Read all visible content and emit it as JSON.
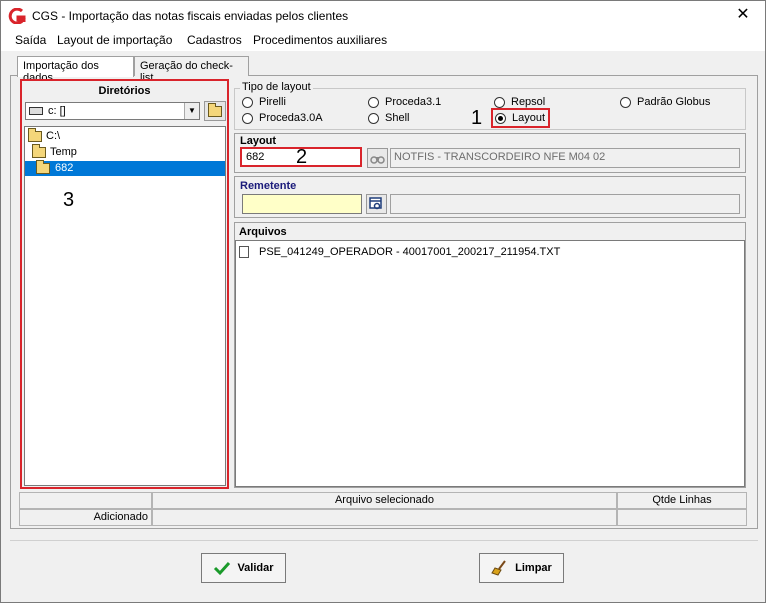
{
  "window": {
    "title": "CGS - Importação das notas fiscais enviadas pelos clientes",
    "close_glyph": "✕"
  },
  "menu": {
    "items": [
      "Saída",
      "Layout de importação",
      "Cadastros",
      "Procedimentos auxiliares"
    ]
  },
  "tabs": [
    {
      "label": "Importação dos dados",
      "active": true
    },
    {
      "label": "Geração do check-list",
      "active": false
    }
  ],
  "directories": {
    "title": "Diretórios",
    "drive": "c: []",
    "tree": [
      {
        "label": "C:\\",
        "level": 0,
        "selected": false
      },
      {
        "label": "Temp",
        "level": 1,
        "selected": false
      },
      {
        "label": "682",
        "level": 2,
        "selected": true
      }
    ]
  },
  "layout_type": {
    "legend": "Tipo de layout",
    "options": [
      {
        "label": "Pirelli",
        "checked": false
      },
      {
        "label": "Proceda3.1",
        "checked": false
      },
      {
        "label": "Repsol",
        "checked": false
      },
      {
        "label": "Padrão Globus",
        "checked": false
      },
      {
        "label": "Proceda3.0A",
        "checked": false
      },
      {
        "label": "Shell",
        "checked": false
      },
      {
        "label": "Layout",
        "checked": true
      }
    ]
  },
  "layout": {
    "label": "Layout",
    "code": "682",
    "description": "NOTFIS - TRANSCORDEIRO NFE M04 02"
  },
  "remetente": {
    "label": "Remetente",
    "code": "",
    "description": ""
  },
  "arquivos": {
    "label": "Arquivos",
    "files": [
      "PSE_041249_OPERADOR - 40017001_200217_211954.TXT"
    ]
  },
  "status": {
    "col_selected": "Arquivo selecionado",
    "col_lines": "Qtde Linhas",
    "row_added": "Adicionado"
  },
  "buttons": {
    "validar": "Validar",
    "limpar": "Limpar"
  },
  "annotations": {
    "n1": "1",
    "n2": "2",
    "n3": "3",
    "highlight_color": "#d9242b"
  },
  "colors": {
    "selection": "#0078d7",
    "brand_red": "#d9242b",
    "remetente_input": "#ffffc8"
  }
}
